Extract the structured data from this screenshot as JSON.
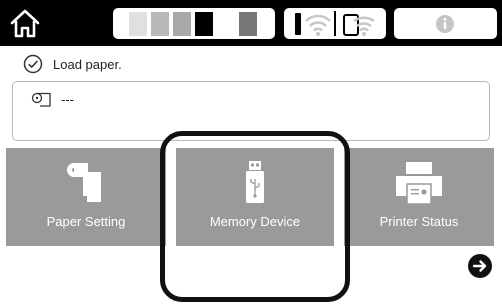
{
  "topbar": {
    "home_icon": "home-icon",
    "ink_colors": [
      "#e0e0e0",
      "#b9b9b9",
      "#a9a9a9",
      "#000000",
      "#777777"
    ],
    "network_icons": [
      "wired-lan-icon",
      "wifi-icon",
      "wifi-direct-icon"
    ],
    "info_icon": "info-icon"
  },
  "status": {
    "icon": "check-circle-icon",
    "message": "Load paper."
  },
  "paper": {
    "icon": "roll-paper-icon",
    "value": "---"
  },
  "tiles": [
    {
      "label": "Paper Setting",
      "icon": "paper-setting-icon"
    },
    {
      "label": "Memory Device",
      "icon": "usb-memory-icon"
    },
    {
      "label": "Printer Status",
      "icon": "printer-icon"
    }
  ],
  "nav": {
    "next_icon": "arrow-right-icon"
  }
}
